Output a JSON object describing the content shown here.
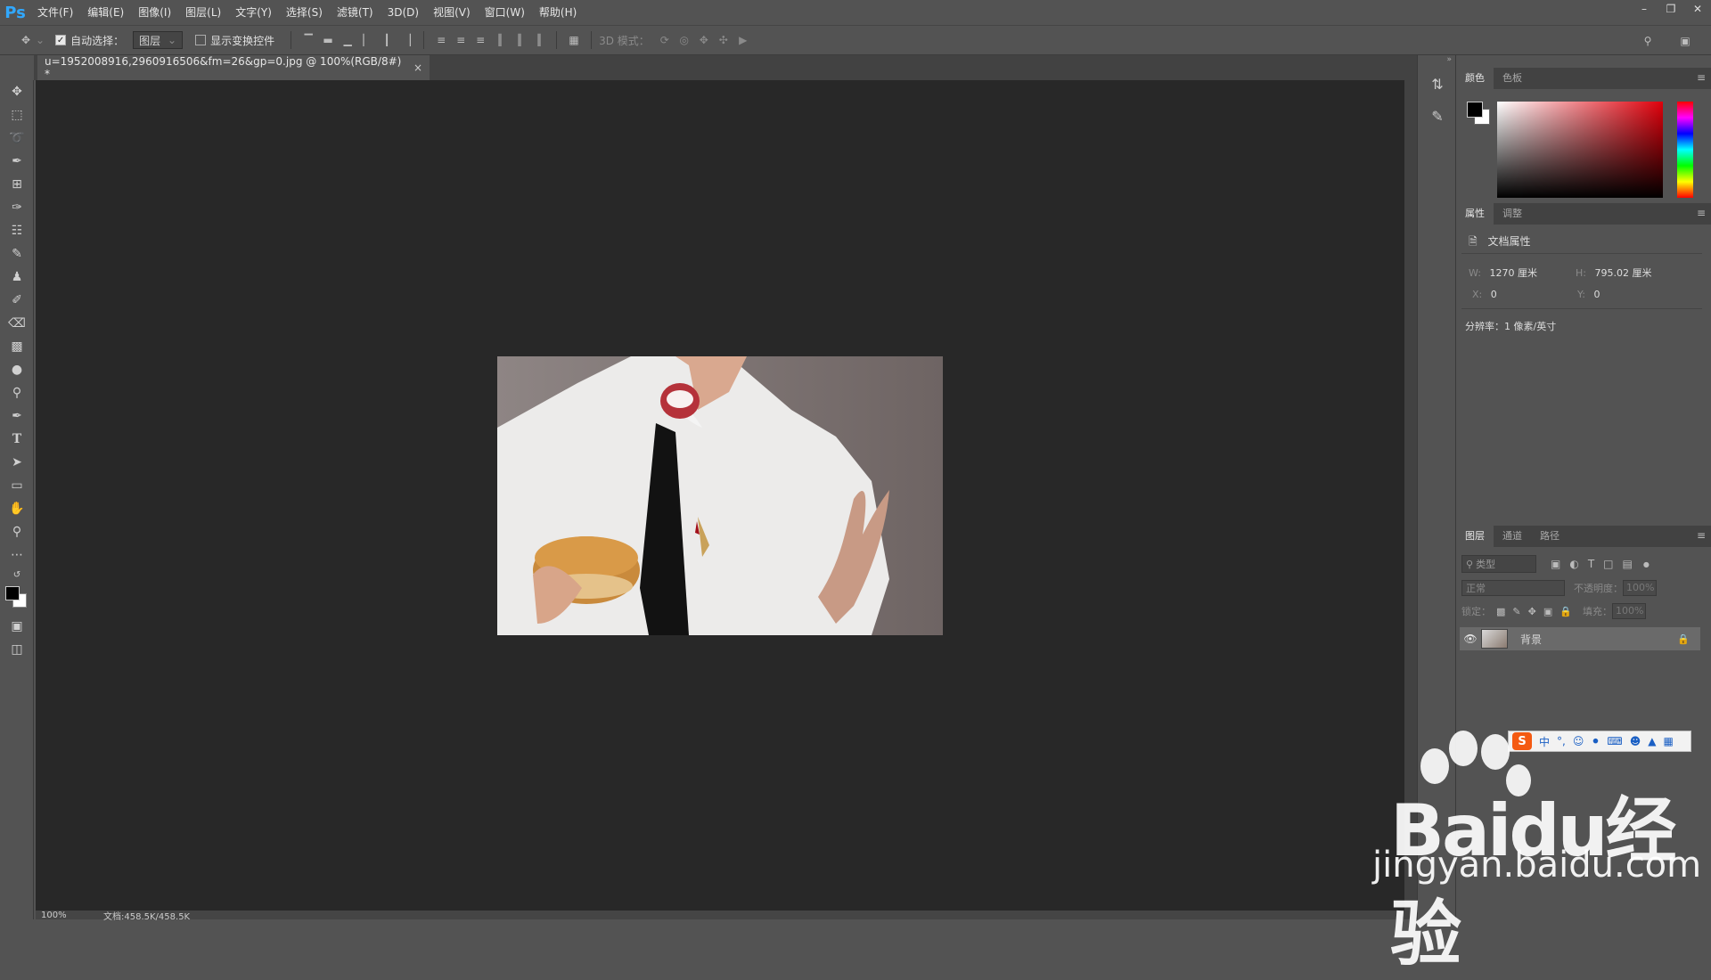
{
  "app": {
    "logo": "Ps"
  },
  "menu": [
    "文件(F)",
    "编辑(E)",
    "图像(I)",
    "图层(L)",
    "文字(Y)",
    "选择(S)",
    "滤镜(T)",
    "3D(D)",
    "视图(V)",
    "窗口(W)",
    "帮助(H)"
  ],
  "options": {
    "auto_select_label": "自动选择：",
    "auto_select_value": "图层",
    "show_transform_label": "显示变换控件",
    "mode_3d_label": "3D 模式："
  },
  "document": {
    "tab_title": "u=1952008916,2960916506&fm=26&gp=0.jpg @ 100%(RGB/8#) *",
    "close": "×"
  },
  "status": {
    "zoom": "100%",
    "doc_size": "文档:458.5K/458.5K"
  },
  "color_panel": {
    "tabs": [
      "颜色",
      "色板"
    ]
  },
  "properties_panel": {
    "tabs": [
      "属性",
      "调整"
    ],
    "section_title": "文档属性",
    "w_label": "W:",
    "w_value": "1270 厘米",
    "h_label": "H:",
    "h_value": "795.02 厘米",
    "x_label": "X:",
    "x_value": "0",
    "y_label": "Y:",
    "y_value": "0",
    "resolution": "分辨率：1 像素/英寸"
  },
  "layers_panel": {
    "tabs": [
      "图层",
      "通道",
      "路径"
    ],
    "filter_placeholder": "类型",
    "blend_mode": "正常",
    "opacity_label": "不透明度：",
    "opacity_value": "100%",
    "lock_label": "锁定：",
    "fill_label": "填充：",
    "fill_value": "100%",
    "layers": [
      {
        "name": "背景"
      }
    ]
  },
  "ime": {
    "mode": "中"
  },
  "watermark": {
    "brand": "Baidu经验",
    "url": "jingyan.baidu.com"
  },
  "colors": {
    "accent": "#31a8ff",
    "canvas_bg": "#282828",
    "panel_bg": "#535353"
  }
}
